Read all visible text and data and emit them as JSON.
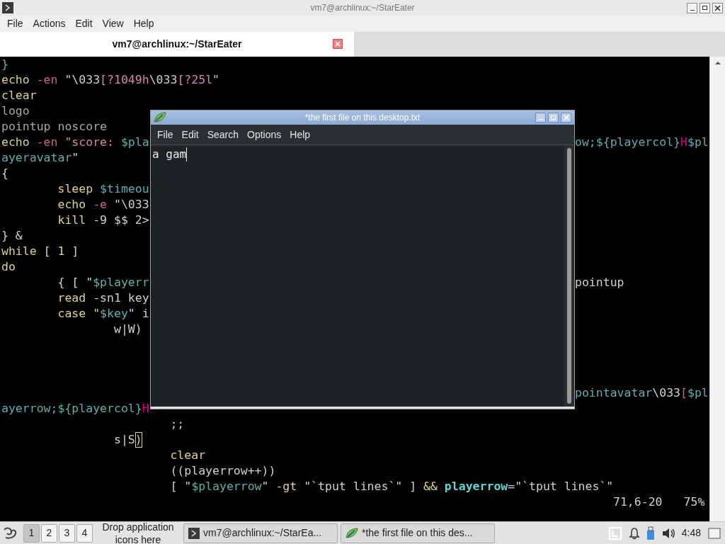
{
  "window": {
    "title": "vm7@archlinux:~/StarEater"
  },
  "menu": [
    "File",
    "Actions",
    "Edit",
    "View",
    "Help"
  ],
  "tabs": [
    {
      "label": "vm7@archlinux:~/StarEater",
      "selected": true
    }
  ],
  "terminal": {
    "lines": [
      {
        "left": [
          {
            "text": "}",
            "color": "#5fafaf"
          }
        ]
      },
      {
        "left": [
          {
            "text": "echo",
            "color": "#d7d787"
          },
          {
            "text": " -en",
            "color": "#d75f87"
          },
          {
            "text": " \"\\033",
            "color": "#d0d0d0"
          },
          {
            "text": "[?1049h",
            "color": "#d787af"
          },
          {
            "text": "\\033",
            "color": "#d0d0d0"
          },
          {
            "text": "[?25l",
            "color": "#d787af"
          },
          {
            "text": "\"",
            "color": "#d0d0d0"
          }
        ]
      },
      {
        "left": [
          {
            "text": "clear",
            "color": "#d7d787"
          }
        ]
      },
      {
        "left": [
          {
            "text": "logo",
            "color": "#a8a8a8"
          }
        ]
      },
      {
        "left": [
          {
            "text": "pointup noscore",
            "color": "#a8a8a8"
          }
        ]
      },
      {
        "left": [
          {
            "text": "echo",
            "color": "#d7d787"
          },
          {
            "text": " -en",
            "color": "#d75f87"
          },
          {
            "text": " \"score: ",
            "color": "#d787af"
          },
          {
            "text": "$pla",
            "color": "#5fafaf"
          }
        ],
        "right": [
          {
            "text": "ow;${playercol}",
            "color": "#5fafaf"
          },
          {
            "text": "H",
            "color": "#d7008f"
          },
          {
            "text": "$pl",
            "color": "#5fafaf"
          }
        ]
      },
      {
        "left": [
          {
            "text": "ayeravatar",
            "color": "#5fafaf"
          },
          {
            "text": "\"",
            "color": "#d0d0d0"
          }
        ]
      },
      {
        "left": [
          {
            "text": "{",
            "color": "#d0d0d0"
          }
        ]
      },
      {
        "left": [
          {
            "text": "        sleep",
            "color": "#d7d787"
          },
          {
            "text": " $timeou",
            "color": "#5fafaf"
          }
        ]
      },
      {
        "left": [
          {
            "text": "        echo",
            "color": "#d7d787"
          },
          {
            "text": " -e",
            "color": "#d75f87"
          },
          {
            "text": " \"\\033",
            "color": "#d0d0d0"
          }
        ]
      },
      {
        "left": [
          {
            "text": "        kill",
            "color": "#d7d787"
          },
          {
            "text": " -9 $$ 2>",
            "color": "#d0d0d0"
          }
        ]
      },
      {
        "left": [
          {
            "text": "} &",
            "color": "#d0d0d0"
          }
        ]
      },
      {
        "left": [
          {
            "text": "while [ 1 ]",
            "color": "#d7d787"
          }
        ]
      },
      {
        "left": [
          {
            "text": "do",
            "color": "#d7d787"
          }
        ]
      },
      {
        "left": [
          {
            "text": "        { [ \"",
            "color": "#d0d0d0"
          },
          {
            "text": "$playerr",
            "color": "#5fafaf"
          }
        ],
        "right": [
          {
            "text": "pointup",
            "color": "#d0d0d0"
          }
        ]
      },
      {
        "left": [
          {
            "text": "        read",
            "color": "#d7d787"
          },
          {
            "text": " -sn1 key",
            "color": "#d0d0d0"
          }
        ]
      },
      {
        "left": [
          {
            "text": "        case",
            "color": "#d7d787"
          },
          {
            "text": " \"",
            "color": "#d0d0d0"
          },
          {
            "text": "$key",
            "color": "#5fafaf"
          },
          {
            "text": "\" i",
            "color": "#d0d0d0"
          }
        ]
      },
      {
        "left": [
          {
            "text": "                w|W)",
            "color": "#d0d0d0"
          }
        ]
      }
    ],
    "lower_lines": [
      {
        "right": [
          {
            "text": "pointavatar",
            "color": "#5fafaf"
          },
          {
            "text": "\\033",
            "color": "#d0d0d0"
          },
          {
            "text": "[",
            "color": "#d75f87"
          },
          {
            "text": "$pl",
            "color": "#5fafaf"
          }
        ]
      },
      {
        "left": [
          {
            "text": "ayerrow;${playercol}",
            "color": "#5fafaf"
          },
          {
            "text": "H",
            "color": "#d7008f"
          }
        ]
      },
      {
        "left": [
          {
            "text": "                        ;;",
            "color": "#d0d0d0"
          }
        ]
      },
      {
        "left": [
          {
            "text": "                s|S",
            "color": "#d0d0d0"
          },
          {
            "text": ")",
            "color": "#d7d787",
            "cursor": true
          }
        ]
      },
      {
        "left": [
          {
            "text": "                        clear",
            "color": "#d7d787"
          }
        ]
      },
      {
        "left": [
          {
            "text": "                        ((playerrow++))",
            "color": "#d0d0d0"
          }
        ]
      },
      {
        "left": [
          {
            "text": "                        [ ",
            "color": "#d7d787"
          },
          {
            "text": "\"",
            "color": "#d0d0d0"
          },
          {
            "text": "$playerrow",
            "color": "#5fafaf"
          },
          {
            "text": "\" -gt ",
            "color": "#d7d787"
          },
          {
            "text": "\"`tput lines`\"",
            "color": "#d0d0d0"
          },
          {
            "text": " ] && ",
            "color": "#d7d787"
          },
          {
            "text": "playerrow",
            "color": "#5fd7d7",
            "bold": true
          },
          {
            "text": "=\"`tput lines`\"",
            "color": "#d0d0d0"
          }
        ]
      }
    ],
    "status": {
      "position": "71,6-20",
      "percent": "75%"
    }
  },
  "editor": {
    "title": "*the first file on this desktop.txt",
    "menu": [
      "File",
      "Edit",
      "Search",
      "Options",
      "Help"
    ],
    "text": "a gam"
  },
  "taskbar": {
    "workspaces": [
      {
        "label": "1",
        "selected": true
      },
      {
        "label": "2",
        "selected": false
      },
      {
        "label": "3",
        "selected": false
      },
      {
        "label": "4",
        "selected": false
      }
    ],
    "drop_hint": "Drop application icons here",
    "tasks": [
      {
        "label": "vm7@archlinux:~/StarEa...",
        "kind": "terminal"
      },
      {
        "label": "*the first file on this des...",
        "kind": "editor"
      }
    ],
    "clock": "4:48"
  }
}
